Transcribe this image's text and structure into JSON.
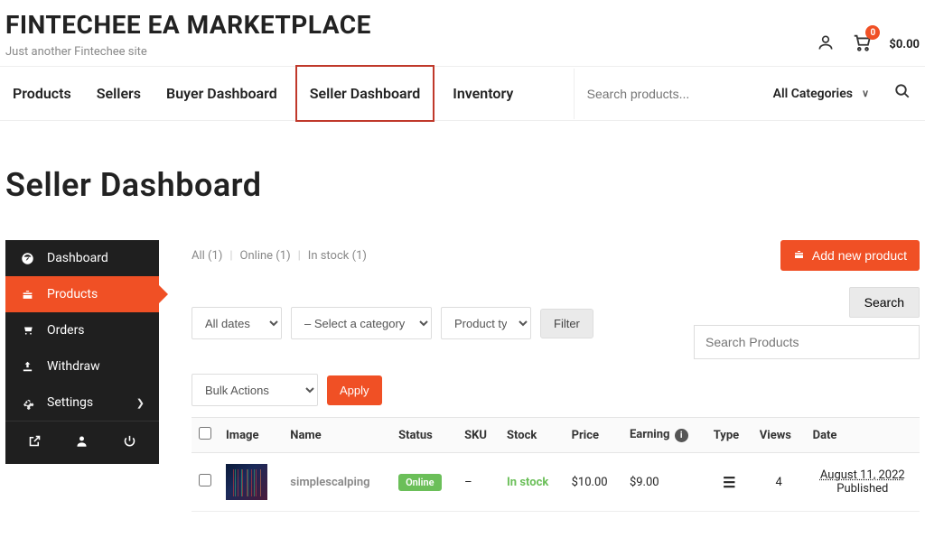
{
  "brand": {
    "title": "FINTECHEE EA MARKETPLACE",
    "tagline": "Just another Fintechee site"
  },
  "header": {
    "cart_count": "0",
    "cart_total": "$0.00"
  },
  "nav": {
    "items": [
      "Products",
      "Sellers",
      "Buyer Dashboard",
      "Seller Dashboard",
      "Inventory"
    ],
    "active_index": 3,
    "search_placeholder": "Search products...",
    "category_label": "All Categories"
  },
  "page": {
    "title": "Seller Dashboard"
  },
  "sidebar": {
    "items": [
      {
        "label": "Dashboard"
      },
      {
        "label": "Products"
      },
      {
        "label": "Orders"
      },
      {
        "label": "Withdraw"
      },
      {
        "label": "Settings"
      }
    ],
    "active_index": 1
  },
  "panel": {
    "status_filters": [
      {
        "label": "All",
        "count": "1"
      },
      {
        "label": "Online",
        "count": "1"
      },
      {
        "label": "In stock",
        "count": "1"
      }
    ],
    "add_button": "Add new product",
    "filters": {
      "dates": "All dates",
      "category": "– Select a category –",
      "product_type": "Product type",
      "filter_btn": "Filter",
      "search_btn": "Search",
      "search_placeholder": "Search Products"
    },
    "bulk": {
      "select": "Bulk Actions",
      "apply": "Apply"
    },
    "table": {
      "headers": [
        "",
        "Image",
        "Name",
        "Status",
        "SKU",
        "Stock",
        "Price",
        "Earning",
        "Type",
        "Views",
        "Date"
      ],
      "row": {
        "name": "simplescalping",
        "status": "Online",
        "sku": "–",
        "stock": "In stock",
        "price": "$10.00",
        "earning": "$9.00",
        "views": "4",
        "date": "August 11, 2022",
        "date_status": "Published"
      }
    }
  }
}
